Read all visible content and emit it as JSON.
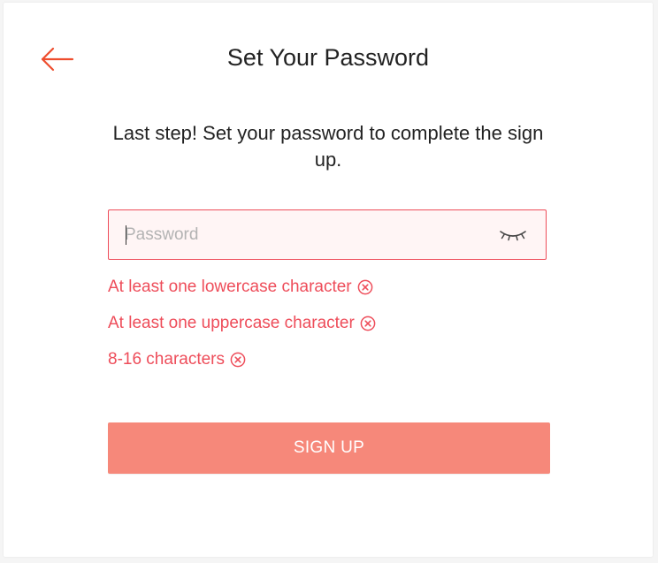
{
  "header": {
    "title": "Set Your Password",
    "back_icon": "arrow-left-icon"
  },
  "main": {
    "subtitle": "Last step! Set your password to complete the sign up."
  },
  "password_field": {
    "value": "",
    "placeholder": "Password",
    "toggle_icon": "eye-closed-icon"
  },
  "requirements": [
    {
      "label": "At least one lowercase character",
      "icon": "x-circle-icon"
    },
    {
      "label": "At least one uppercase character",
      "icon": "x-circle-icon"
    },
    {
      "label": "8-16 characters",
      "icon": "x-circle-icon"
    }
  ],
  "actions": {
    "signup_label": "SIGN UP"
  },
  "colors": {
    "accent": "#ee4d2d",
    "error": "#ee4d5a",
    "input_bg": "#fff5f5",
    "button_bg": "#f6887a"
  }
}
